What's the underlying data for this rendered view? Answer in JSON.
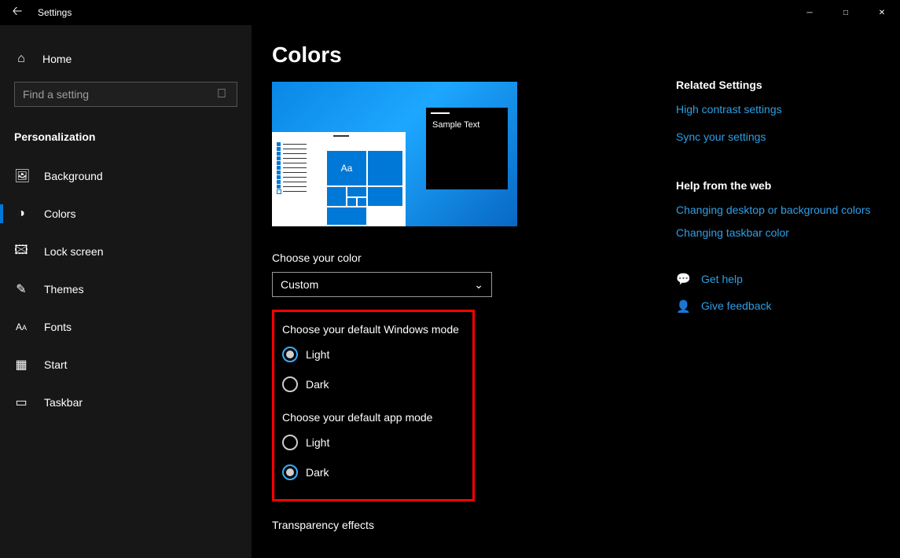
{
  "window": {
    "title": "Settings"
  },
  "sidebar": {
    "home": "Home",
    "search_placeholder": "Find a setting",
    "category": "Personalization",
    "items": [
      {
        "label": "Background",
        "icon": "🖼"
      },
      {
        "label": "Colors",
        "icon": "🎨"
      },
      {
        "label": "Lock screen",
        "icon": "🔒"
      },
      {
        "label": "Themes",
        "icon": "✎"
      },
      {
        "label": "Fonts",
        "icon": "A"
      },
      {
        "label": "Start",
        "icon": "⊞"
      },
      {
        "label": "Taskbar",
        "icon": "▭"
      }
    ],
    "active_index": 1
  },
  "page": {
    "title": "Colors",
    "preview_sample_text": "Sample Text",
    "preview_aa": "Aa",
    "choose_color_label": "Choose your color",
    "color_mode_value": "Custom",
    "windows_mode_label": "Choose your default Windows mode",
    "windows_mode_options": [
      "Light",
      "Dark"
    ],
    "windows_mode_selected": "Light",
    "app_mode_label": "Choose your default app mode",
    "app_mode_options": [
      "Light",
      "Dark"
    ],
    "app_mode_selected": "Dark",
    "transparency_label": "Transparency effects"
  },
  "right": {
    "related_head": "Related Settings",
    "links1": [
      "High contrast settings",
      "Sync your settings"
    ],
    "webhelp_head": "Help from the web",
    "links2": [
      "Changing desktop or background colors",
      "Changing taskbar color"
    ],
    "get_help": "Get help",
    "feedback": "Give feedback"
  }
}
